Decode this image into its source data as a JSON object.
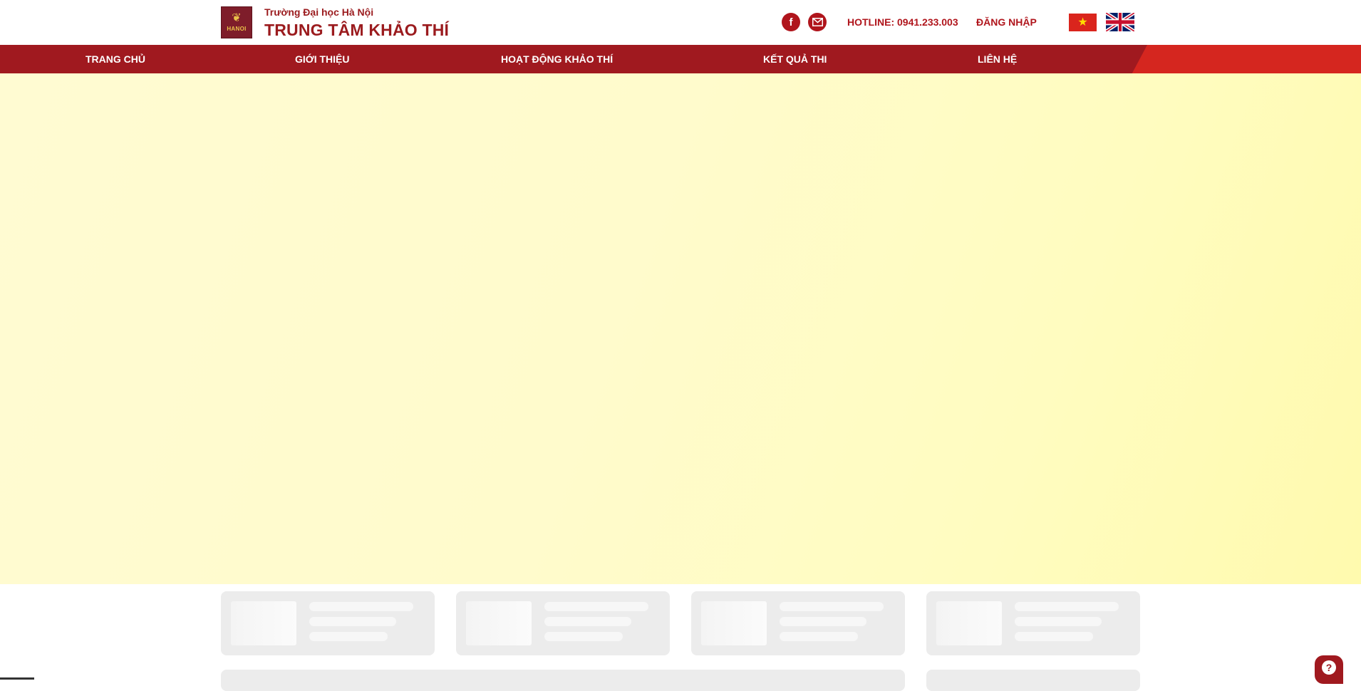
{
  "header": {
    "logo_text": "HANOI",
    "subtitle": "Trường Đại học Hà Nội",
    "title": "TRUNG TÂM KHẢO THÍ",
    "hotline": "HOTLINE: 0941.233.003",
    "login": "ĐĂNG NHẬP",
    "social": [
      {
        "name": "facebook-icon",
        "glyph": "f"
      },
      {
        "name": "mail-icon"
      }
    ],
    "languages": [
      "vietnamese-flag",
      "english-flag"
    ]
  },
  "nav": {
    "items": [
      {
        "label": "TRANG CHỦ"
      },
      {
        "label": "GIỚI THIỆU"
      },
      {
        "label": "HOẠT ĐỘNG KHẢO THÍ"
      },
      {
        "label": "KẾT QUẢ THI"
      },
      {
        "label": "LIÊN HỆ"
      }
    ]
  },
  "help": {
    "glyph": "?"
  },
  "colors": {
    "brand_red": "#a0191f",
    "accent_red": "#d5261f",
    "hero_yellow": "#fffbcc",
    "skeleton_gray": "#ececec"
  }
}
